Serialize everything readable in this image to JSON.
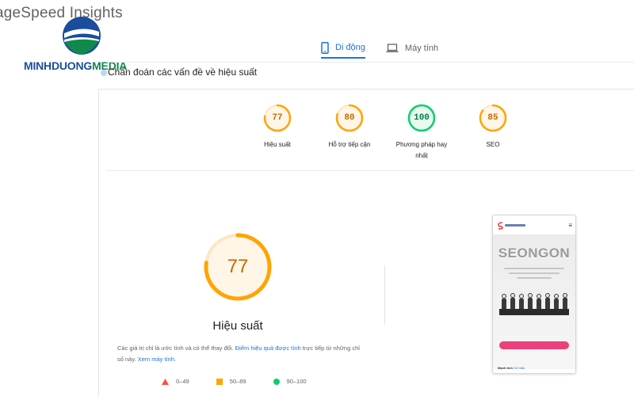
{
  "app": {
    "title": "ageSpeed Insights"
  },
  "logo": {
    "text_main": "MINHDUONG",
    "text_accent": "MEDIA"
  },
  "tabs": [
    {
      "label": "Di động",
      "icon": "smartphone-icon",
      "active": true
    },
    {
      "label": "Máy tính",
      "icon": "laptop-icon",
      "active": false
    }
  ],
  "diagnostics": {
    "heading": "Chẩn đoán các vấn đề về hiệu suất"
  },
  "scores": [
    {
      "label": "Hiệu suất",
      "value": "77",
      "score": 77,
      "color": "#ffa400",
      "text_color": "#c26b00"
    },
    {
      "label": "Hỗ trợ tiếp cận",
      "value": "80",
      "score": 80,
      "color": "#ffa400",
      "text_color": "#c26b00"
    },
    {
      "label_line1": "Phương pháp hay",
      "label_line2": "nhất",
      "value": "100",
      "score": 100,
      "color": "#0cce6b",
      "text_color": "#0a7c43"
    },
    {
      "label": "SEO",
      "value": "85",
      "score": 85,
      "color": "#ffa400",
      "text_color": "#c26b00"
    }
  ],
  "main_score": {
    "value": "77",
    "score": 77,
    "title": "Hiệu suất",
    "color": "#ffa400"
  },
  "description": {
    "text1": "Các giá trị chỉ là ước tính và có thể thay đổi. ",
    "link1": "Điểm hiệu quả được tính",
    "text2": " trực tiếp từ những chỉ số này. ",
    "link2": "Xem máy tính."
  },
  "legend": [
    {
      "range": "0–49",
      "shape": "triangle",
      "color": "#ff4e42"
    },
    {
      "range": "50–89",
      "shape": "square",
      "color": "#ffa400"
    },
    {
      "range": "90–100",
      "shape": "circle",
      "color": "#0cce6b"
    }
  ],
  "preview": {
    "brand": "SEONGON",
    "footer_text": "Mạnh tính ",
    "footer_link": "Cỡ mẫu"
  }
}
